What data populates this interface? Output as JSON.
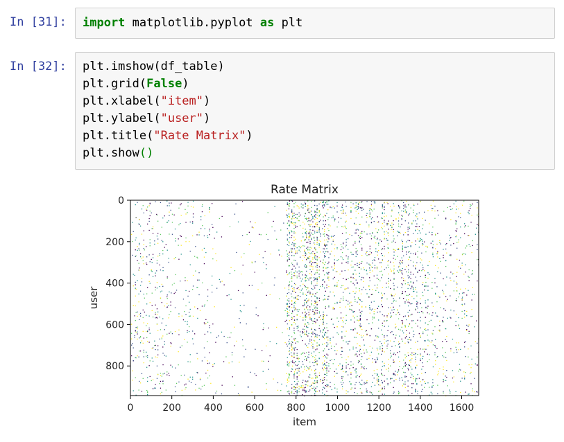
{
  "cells": [
    {
      "prompt": "In [31]:",
      "code_lines": [
        [
          {
            "t": "import",
            "c": "kw"
          },
          {
            "t": " matplotlib.pyplot ",
            "c": ""
          },
          {
            "t": "as",
            "c": "kw"
          },
          {
            "t": " plt",
            "c": ""
          }
        ]
      ]
    },
    {
      "prompt": "In [32]:",
      "code_lines": [
        [
          {
            "t": "plt.imshow(df_table)",
            "c": ""
          }
        ],
        [
          {
            "t": "plt.grid(",
            "c": ""
          },
          {
            "t": "False",
            "c": "kw"
          },
          {
            "t": ")",
            "c": ""
          }
        ],
        [
          {
            "t": "plt.xlabel(",
            "c": ""
          },
          {
            "t": "\"item\"",
            "c": "str"
          },
          {
            "t": ")",
            "c": ""
          }
        ],
        [
          {
            "t": "plt.ylabel(",
            "c": ""
          },
          {
            "t": "\"user\"",
            "c": "str"
          },
          {
            "t": ")",
            "c": ""
          }
        ],
        [
          {
            "t": "plt.title(",
            "c": ""
          },
          {
            "t": "\"Rate Matrix\"",
            "c": "str"
          },
          {
            "t": ")",
            "c": ""
          }
        ],
        [
          {
            "t": "plt.show",
            "c": ""
          },
          {
            "t": "()",
            "c": "par"
          }
        ]
      ]
    }
  ],
  "chart_data": {
    "type": "heatmap",
    "title": "Rate Matrix",
    "xlabel": "item",
    "ylabel": "user",
    "xlim": [
      0,
      1682
    ],
    "ylim": [
      943,
      0
    ],
    "xticks": [
      0,
      200,
      400,
      600,
      800,
      1000,
      1200,
      1400,
      1600
    ],
    "yticks": [
      0,
      200,
      400,
      600,
      800
    ],
    "colormap": [
      "#440154",
      "#3b528b",
      "#21918c",
      "#5ec962",
      "#fde725"
    ],
    "density_profile": [
      {
        "x": [
          0,
          150
        ],
        "density": 0.12
      },
      {
        "x": [
          150,
          400
        ],
        "density": 0.08
      },
      {
        "x": [
          400,
          750
        ],
        "density": 0.03
      },
      {
        "x": [
          750,
          950
        ],
        "density": 0.45
      },
      {
        "x": [
          950,
          1400
        ],
        "density": 0.22
      },
      {
        "x": [
          1400,
          1682
        ],
        "density": 0.12
      }
    ]
  }
}
